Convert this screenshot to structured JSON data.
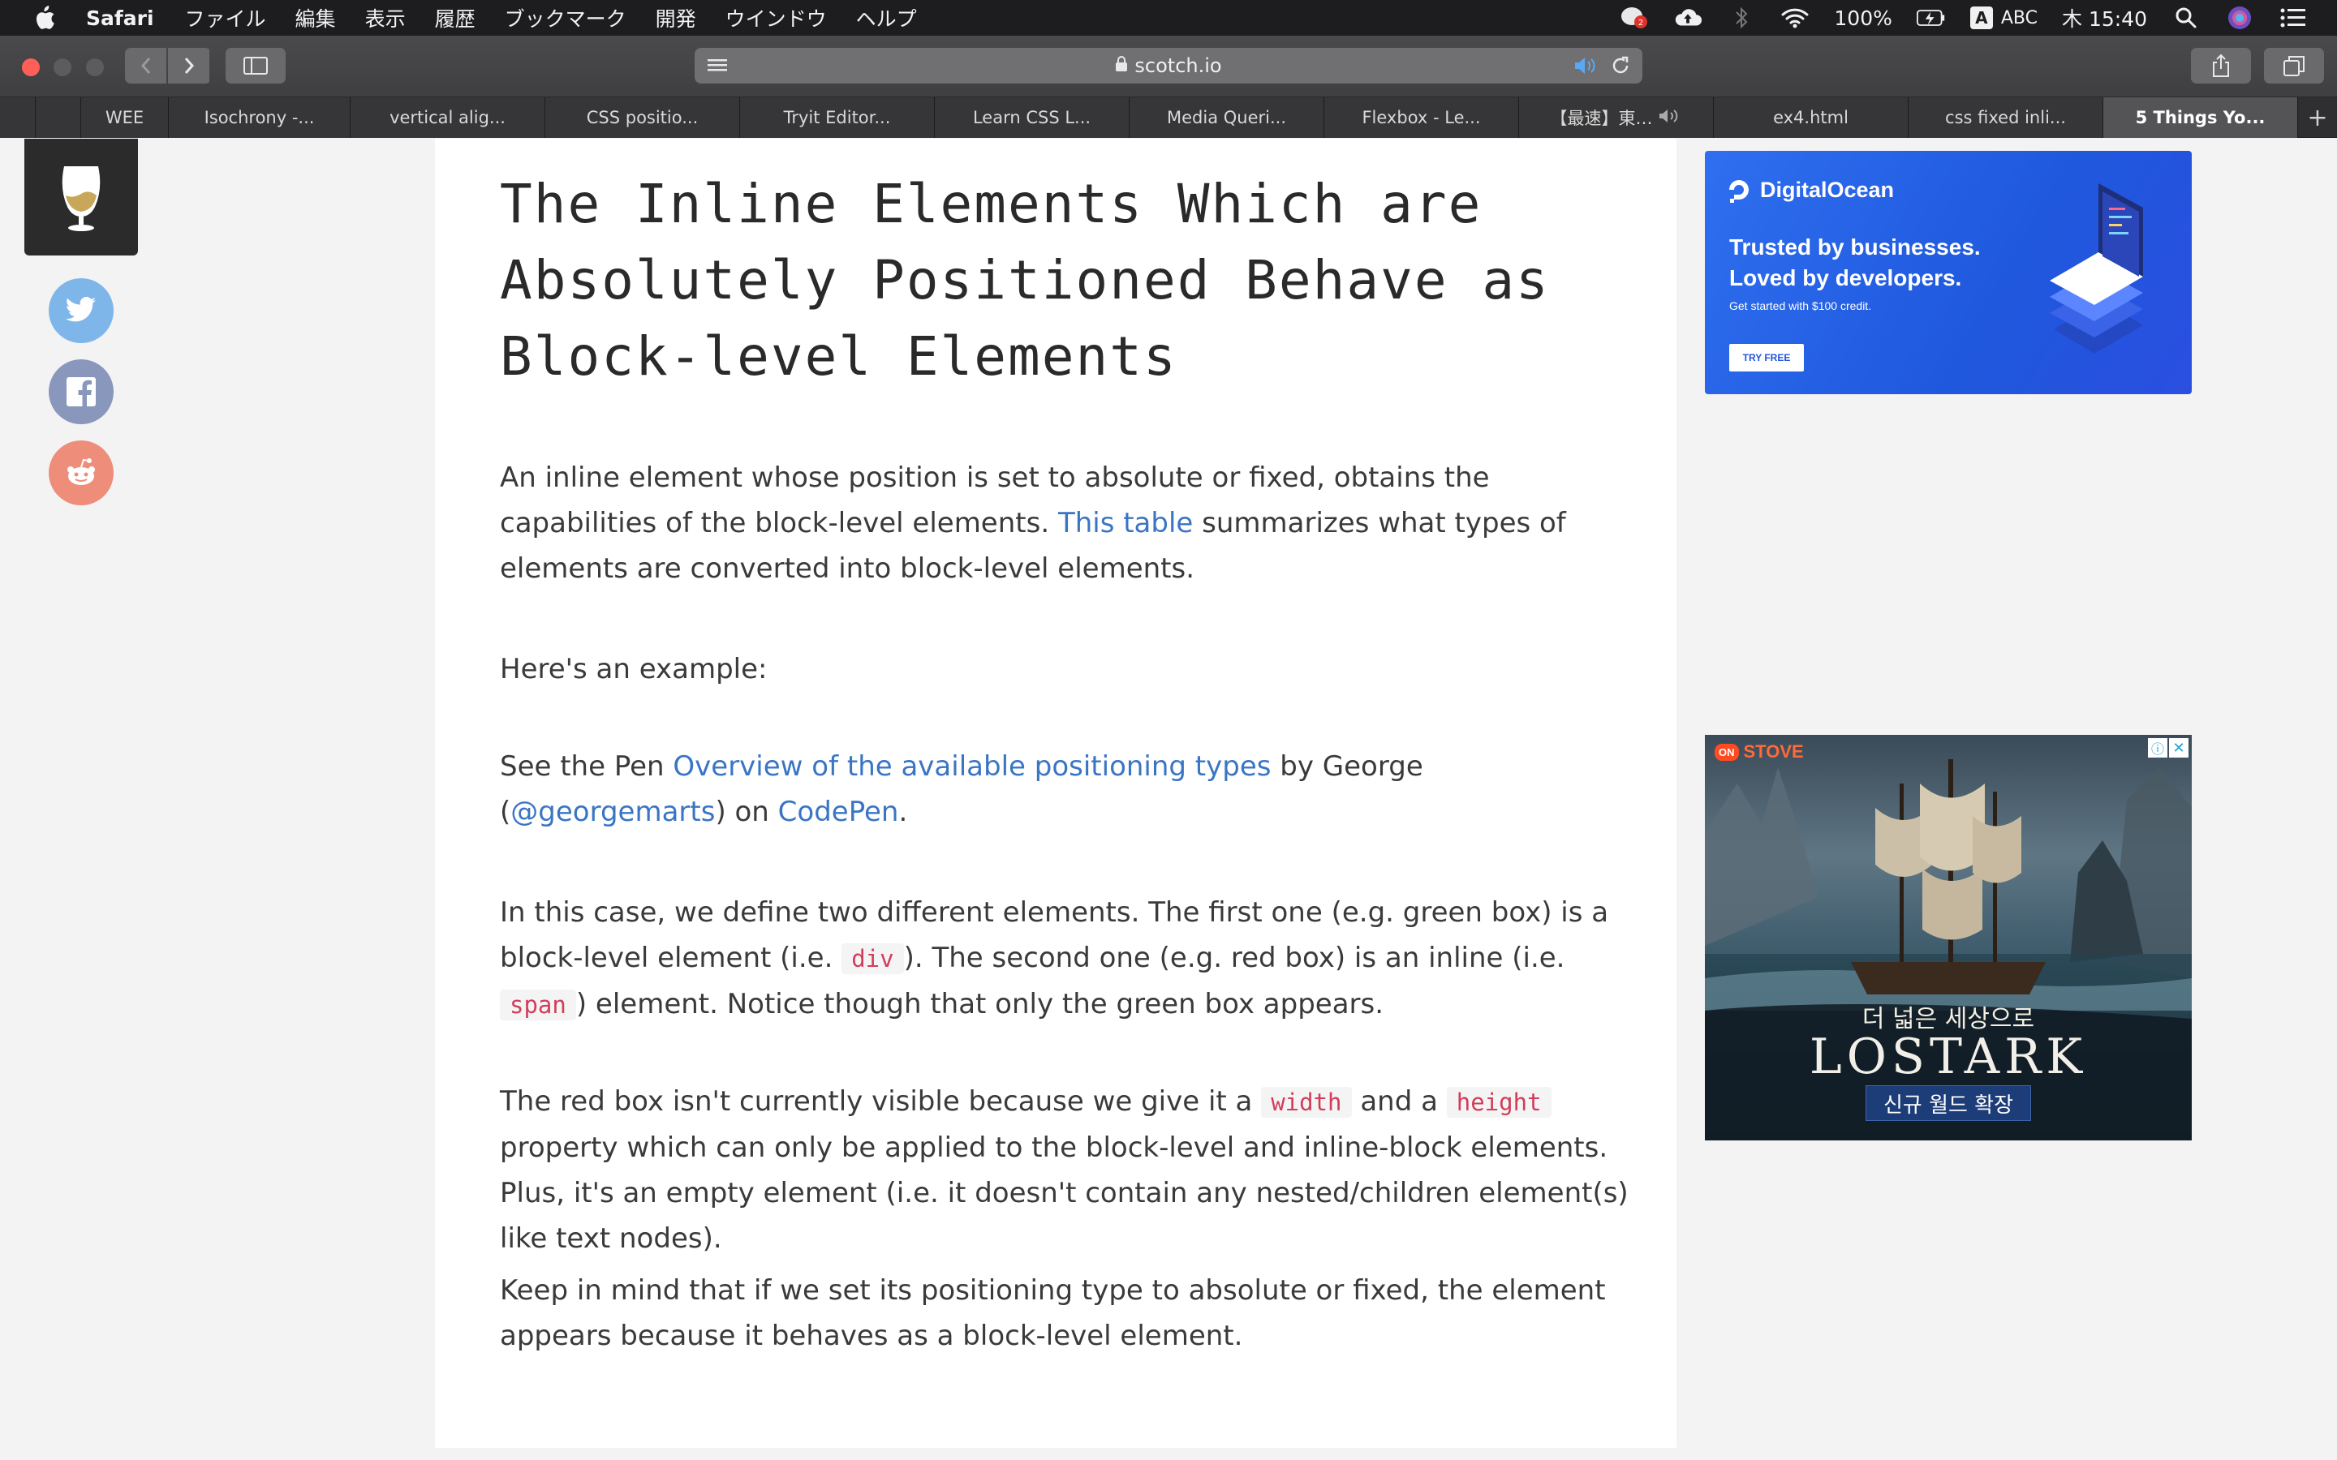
{
  "menubar": {
    "app_name": "Safari",
    "menus": [
      "ファイル",
      "編集",
      "表示",
      "履歴",
      "ブックマーク",
      "開発",
      "ウインドウ",
      "ヘルプ"
    ],
    "battery": "100%",
    "input_source": "ABC",
    "input_badge": "A",
    "clock": "木 15:40"
  },
  "toolbar": {
    "url": "scotch.io"
  },
  "tabs": [
    {
      "label": ""
    },
    {
      "label": "WEE"
    },
    {
      "label": "Isochrony -..."
    },
    {
      "label": "vertical alig..."
    },
    {
      "label": "CSS positio..."
    },
    {
      "label": "Tryit Editor..."
    },
    {
      "label": "Learn CSS L..."
    },
    {
      "label": "Media Queri..."
    },
    {
      "label": "Flexbox - Le..."
    },
    {
      "label": "【最速】東…"
    },
    {
      "label": "ex4.html"
    },
    {
      "label": "css fixed inli..."
    },
    {
      "label": "5 Things Yo..."
    }
  ],
  "tab_add": "+",
  "article": {
    "title": "The Inline Elements Which are Absolutely Positioned Behave as Block-level Elements",
    "p1_a": "An inline element whose position is set to absolute or fixed, obtains the capabilities of the block-level elements. ",
    "p1_link": "This table",
    "p1_b": " summarizes what types of elements are converted into block-level elements.",
    "p2": "Here's an example:",
    "p3_a": "See the Pen ",
    "p3_link1": "Overview of the available positioning types",
    "p3_b": " by George (",
    "p3_link2": "@georgemarts",
    "p3_c": ") on ",
    "p3_link3": "CodePen",
    "p3_d": ".",
    "p4_a": "In this case, we define two different elements. The first one (e.g. green box) is a block-level element (i.e. ",
    "p4_code1": "div",
    "p4_b": "). The second one (e.g. red box) is an inline (i.e. ",
    "p4_code2": "span",
    "p4_c": ") element. Notice though that only the green box appears.",
    "p5_a": "The red box isn't currently visible because we give it a ",
    "p5_code1": "width",
    "p5_b": " and a ",
    "p5_code2": "height",
    "p5_c": " property which can only be applied to the block-level and inline-block elements. Plus, it's an empty element (i.e. it doesn't contain any nested/children element(s) like text nodes).",
    "p6": "Keep in mind that if we set its positioning type to absolute or fixed, the element appears because it behaves as a block-level element."
  },
  "ads": {
    "digitalocean": {
      "brand": "DigitalOcean",
      "headline1": "Trusted by businesses.",
      "headline2": "Loved by developers.",
      "sub": "Get started with $100 credit.",
      "cta": "TRY FREE"
    },
    "lostark": {
      "badge": "ON",
      "network": "STOVE",
      "info": "ⓘ",
      "close": "✕",
      "tagline": "더 넓은 세상으로",
      "title": "LOSTARK",
      "button": "신규 월드 확장"
    }
  },
  "colors": {
    "link": "#3a75c4",
    "code_text": "#d23d5a",
    "menubar_bg": "#1d1d1f",
    "tab_active_bg": "#545456"
  }
}
